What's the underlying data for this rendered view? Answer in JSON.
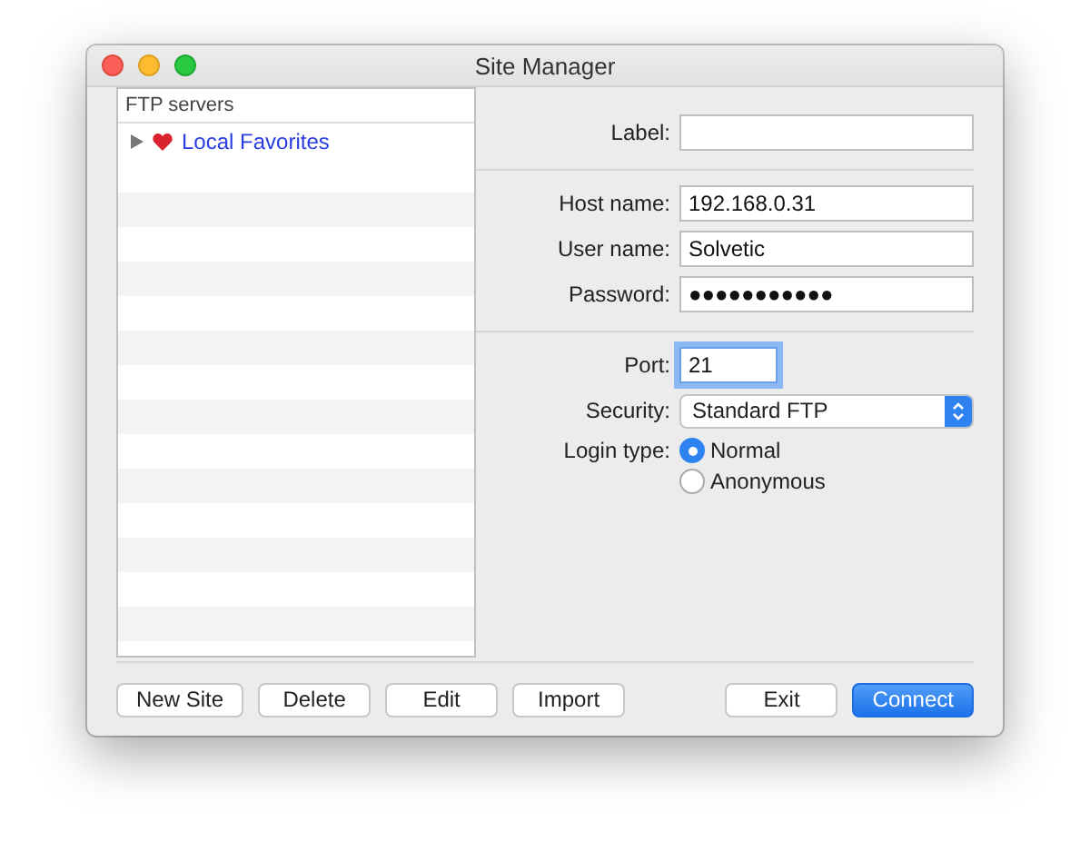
{
  "window": {
    "title": "Site Manager"
  },
  "site_list": {
    "header": "FTP servers",
    "items": [
      {
        "label": "Local Favorites",
        "expanded": false
      }
    ]
  },
  "form": {
    "groups": [
      [
        {
          "label": "Label:",
          "kind": "text",
          "focused": false
        }
      ],
      [
        {
          "label": "Host name:",
          "kind": "text",
          "value": "192.168.0.31",
          "focused": false
        },
        {
          "label": "User name:",
          "kind": "text",
          "value": "Solvetic",
          "focused": false
        },
        {
          "label": "Password:",
          "kind": "text",
          "value": "●●●●●●●●●●●",
          "focused": false
        }
      ],
      [
        {
          "label": "Port:",
          "kind": "short",
          "value": "21",
          "focused": true
        },
        {
          "label": "Security:",
          "kind": "select",
          "value": "Standard FTP"
        },
        {
          "label": "Login type:",
          "kind": "radio",
          "options": [
            {
              "label": "Normal",
              "selected": true
            },
            {
              "label": "Anonymous",
              "selected": false
            }
          ]
        }
      ]
    ]
  },
  "left_buttons": [
    {
      "label": "New Site",
      "default": false
    },
    {
      "label": "Delete",
      "default": false
    },
    {
      "label": "Edit",
      "default": false
    },
    {
      "label": "Import",
      "default": false
    }
  ],
  "right_buttons": [
    {
      "label": "Exit",
      "default": false
    },
    {
      "label": "Connect",
      "default": true
    }
  ]
}
